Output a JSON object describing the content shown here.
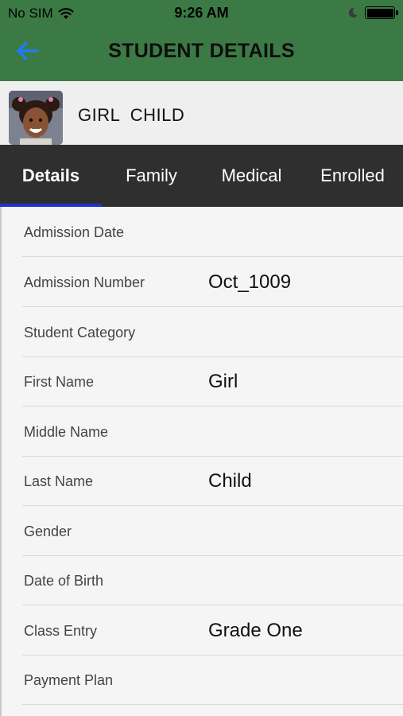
{
  "status_bar": {
    "carrier": "No SIM",
    "time": "9:26 AM"
  },
  "nav": {
    "title": "STUDENT DETAILS",
    "back_icon": "arrow-left-icon"
  },
  "profile": {
    "name": "GIRL  CHILD"
  },
  "tabs": [
    {
      "label": "Details",
      "active": true
    },
    {
      "label": "Family",
      "active": false
    },
    {
      "label": "Medical",
      "active": false
    },
    {
      "label": "Enrolled",
      "active": false
    }
  ],
  "fields": [
    {
      "label": "Admission Date",
      "value": ""
    },
    {
      "label": "Admission Number",
      "value": "Oct_1009"
    },
    {
      "label": "Student Category",
      "value": ""
    },
    {
      "label": "First Name",
      "value": "Girl"
    },
    {
      "label": "Middle Name",
      "value": ""
    },
    {
      "label": "Last Name",
      "value": "Child"
    },
    {
      "label": "Gender",
      "value": ""
    },
    {
      "label": "Date of Birth",
      "value": ""
    },
    {
      "label": "Class Entry",
      "value": "Grade One"
    },
    {
      "label": "Payment Plan",
      "value": ""
    }
  ],
  "colors": {
    "header": "#3c7a45",
    "tab_bar": "#2f2f2f",
    "tab_indicator": "#1f35c9",
    "back_arrow": "#1e7cf2"
  }
}
